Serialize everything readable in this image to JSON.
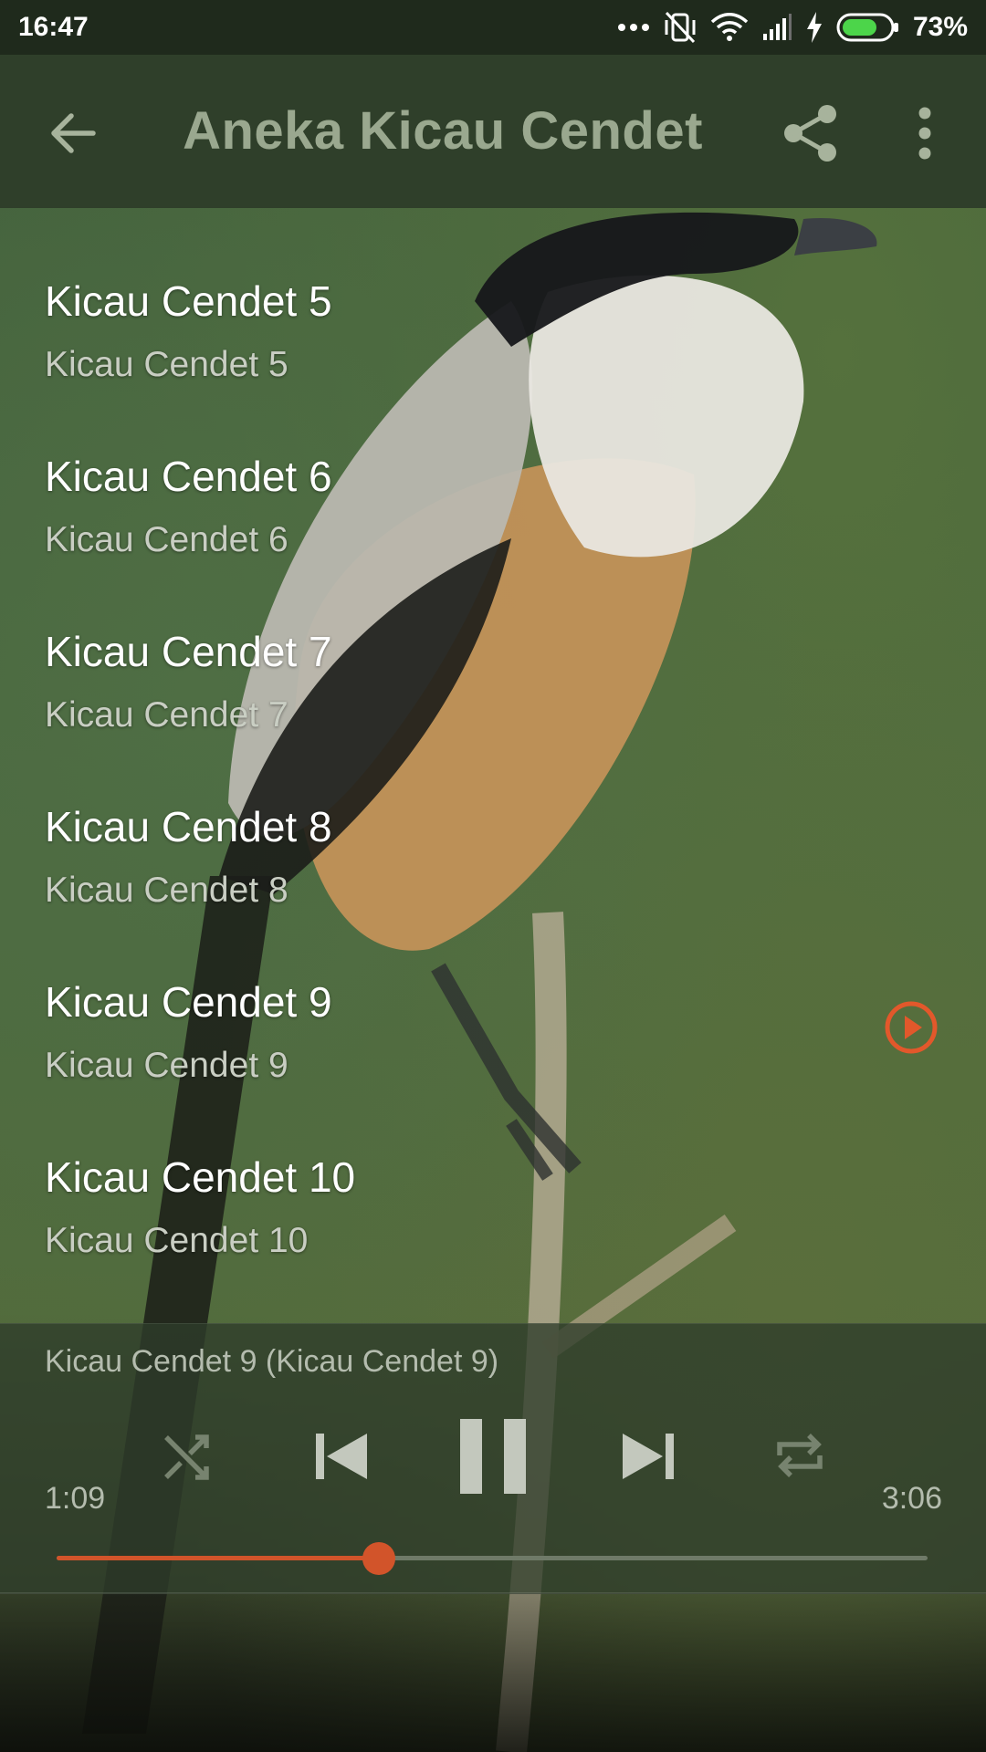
{
  "status_bar": {
    "time": "16:47",
    "battery_percent": "73%",
    "battery_level": 0.73,
    "icons": [
      "more-dots-icon",
      "vibrate-off-icon",
      "wifi-icon",
      "cell-signal-icon",
      "charging-icon",
      "battery-icon"
    ]
  },
  "app_bar": {
    "title": "Aneka Kicau Cendet",
    "back_icon": "arrow-back-icon",
    "share_icon": "share-icon",
    "more_icon": "more-vert-icon"
  },
  "tracks": [
    {
      "title": "Kicau Cendet 5",
      "subtitle": "Kicau Cendet 5",
      "playing": false
    },
    {
      "title": "Kicau Cendet 6",
      "subtitle": "Kicau Cendet 6",
      "playing": false
    },
    {
      "title": "Kicau Cendet 7",
      "subtitle": "Kicau Cendet 7",
      "playing": false
    },
    {
      "title": "Kicau Cendet 8",
      "subtitle": "Kicau Cendet 8",
      "playing": false
    },
    {
      "title": "Kicau Cendet 9",
      "subtitle": "Kicau Cendet 9",
      "playing": true
    },
    {
      "title": "Kicau Cendet 10",
      "subtitle": "Kicau Cendet 10",
      "playing": false
    }
  ],
  "player": {
    "now_playing": "Kicau Cendet 9 (Kicau Cendet 9)",
    "elapsed": "1:09",
    "duration": "3:06",
    "progress": 0.37,
    "controls": [
      "shuffle-icon",
      "skip-previous-icon",
      "pause-icon",
      "skip-next-icon",
      "repeat-icon"
    ]
  },
  "colors": {
    "accent": "#d2542a",
    "app_bar": "#2f3f2a",
    "status_bar": "#1f2a1c",
    "title_text": "#9aa88f"
  }
}
